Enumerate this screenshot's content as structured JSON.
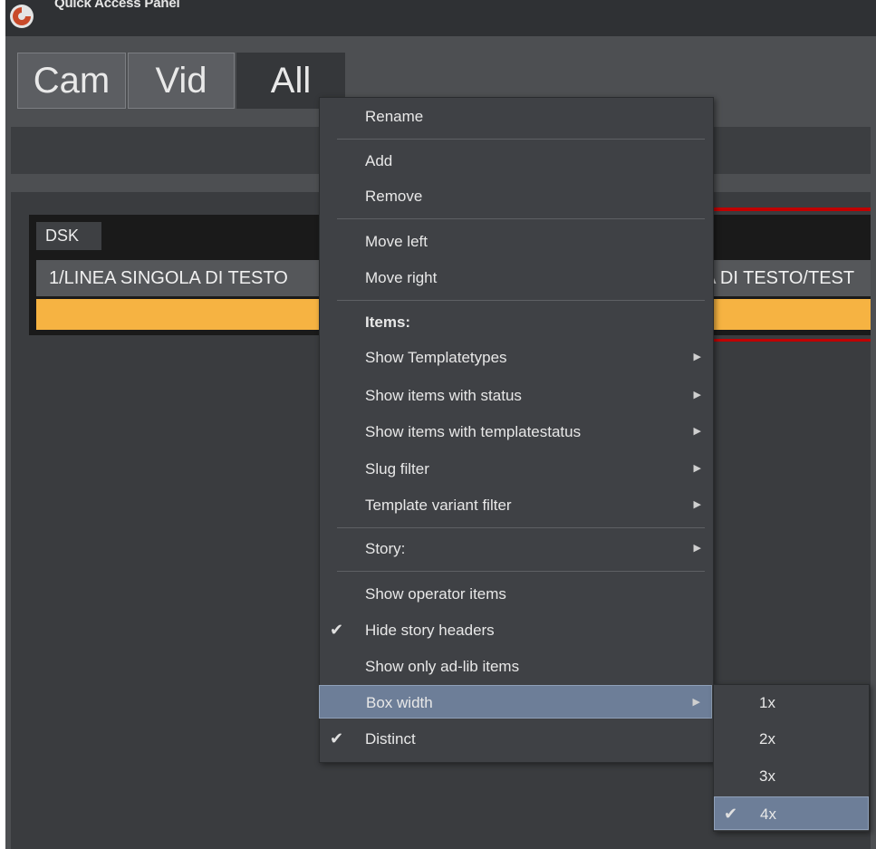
{
  "window": {
    "title": "Quick Access Panel"
  },
  "tabs": [
    {
      "label": "Cam",
      "active": false
    },
    {
      "label": "Vid",
      "active": false
    },
    {
      "label": "All",
      "active": true
    }
  ],
  "item": {
    "category": "DSK",
    "row_text": "1/LINEA SINGOLA DI TESTO",
    "row_text_right": "LA DI TESTO/TEST",
    "highlight_color": "#f6b342",
    "border_color": "#c00000"
  },
  "menu": {
    "rename": "Rename",
    "add": "Add",
    "remove": "Remove",
    "move_left": "Move left",
    "move_right": "Move right",
    "items_header": "Items:",
    "show_templatetypes": "Show Templatetypes",
    "show_items_status": "Show items with status",
    "show_items_templatestatus": "Show items with templatestatus",
    "slug_filter": "Slug filter",
    "template_variant_filter": "Template variant filter",
    "story": "Story:",
    "show_operator_items": "Show operator items",
    "hide_story_headers": "Hide story headers",
    "show_only_adlib": "Show only ad-lib items",
    "box_width": "Box width",
    "distinct": "Distinct"
  },
  "submenu": {
    "options": [
      "1x",
      "2x",
      "3x",
      "4x"
    ],
    "selected": "4x"
  },
  "glyphs": {
    "arrow": "▶",
    "check": "✔"
  }
}
